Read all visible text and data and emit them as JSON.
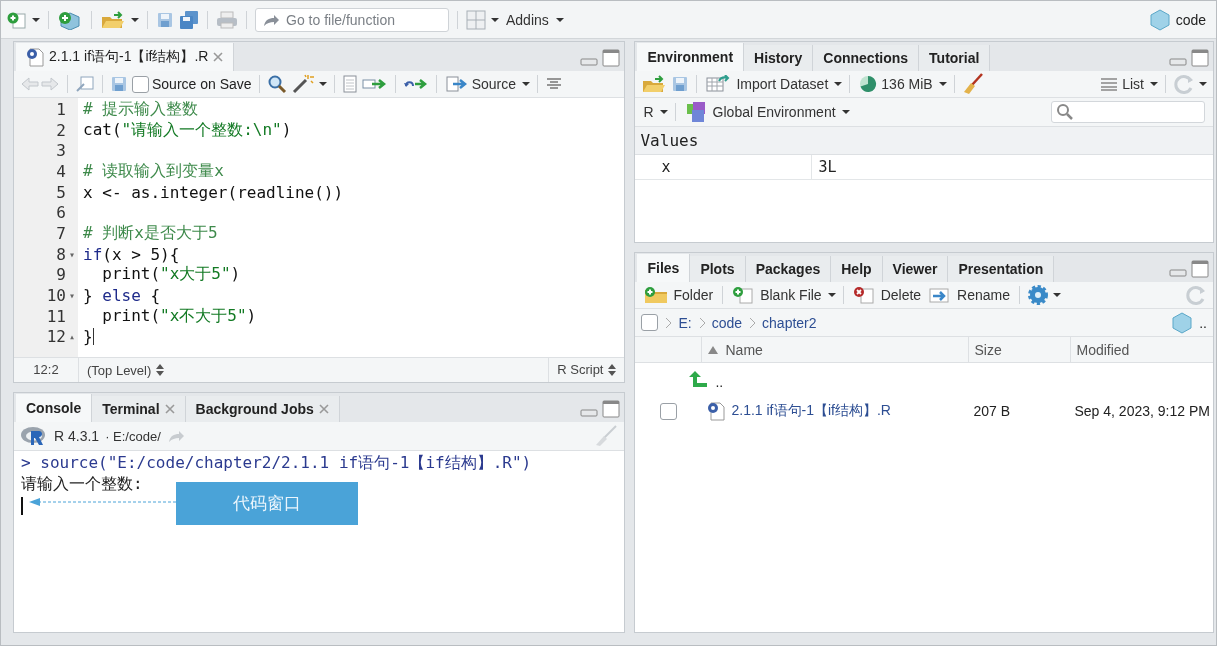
{
  "toolbar": {
    "go_to_placeholder": "Go to file/function",
    "addins": "Addins",
    "project": "code"
  },
  "editor": {
    "tabs": [
      {
        "label": "2.1.1 if语句-1【if结构】.R",
        "selected": true
      }
    ],
    "source_on_save": {
      "label": "Source on Save",
      "checked": false
    },
    "source_button": "Source",
    "lines": [
      {
        "number": "1",
        "tokens": [
          {
            "kind": "comment",
            "text": "# 提示输入整数"
          }
        ]
      },
      {
        "number": "2",
        "tokens": [
          {
            "kind": "plain",
            "text": "cat("
          },
          {
            "kind": "string",
            "text": "\"请输入一个整数:\\n\""
          },
          {
            "kind": "plain",
            "text": ")"
          }
        ]
      },
      {
        "number": "3"
      },
      {
        "number": "4",
        "tokens": [
          {
            "kind": "comment",
            "text": "# 读取输入到变量x"
          }
        ]
      },
      {
        "number": "5",
        "tokens": [
          {
            "kind": "plain",
            "text": "x <- as.integer(readline())"
          }
        ]
      },
      {
        "number": "6"
      },
      {
        "number": "7",
        "tokens": [
          {
            "kind": "comment",
            "text": "# 判断x是否大于5"
          }
        ]
      },
      {
        "number": "8",
        "fold": "▾",
        "tokens": [
          {
            "kind": "keyword",
            "text": "if"
          },
          {
            "kind": "plain",
            "text": "(x > 5){"
          }
        ]
      },
      {
        "number": "9",
        "tokens": [
          {
            "kind": "plain",
            "text": "  print("
          },
          {
            "kind": "string",
            "text": "\"x大于5\""
          },
          {
            "kind": "plain",
            "text": ")"
          }
        ]
      },
      {
        "number": "10",
        "fold": "▾",
        "tokens": [
          {
            "kind": "plain",
            "text": "} "
          },
          {
            "kind": "keyword",
            "text": "else"
          },
          {
            "kind": "plain",
            "text": " {"
          }
        ]
      },
      {
        "number": "11",
        "tokens": [
          {
            "kind": "plain",
            "text": "  print("
          },
          {
            "kind": "string",
            "text": "\"x不大于5\""
          },
          {
            "kind": "plain",
            "text": ")"
          }
        ]
      },
      {
        "number": "12",
        "fold": "▴",
        "cursor": true,
        "tokens": [
          {
            "kind": "plain",
            "text": "}"
          }
        ]
      }
    ],
    "cursor_position": "12:2",
    "scope": "(Top Level)",
    "file_type": "R Script"
  },
  "console": {
    "tabs": [
      {
        "label": "Console",
        "selected": true,
        "closable": false
      },
      {
        "label": "Terminal",
        "selected": false,
        "closable": true
      },
      {
        "label": "Background Jobs",
        "selected": false,
        "closable": true
      }
    ],
    "version": "R 4.3.1",
    "path": "· E:/code/",
    "lines": [
      {
        "kind": "input",
        "text": "> source(\"E:/code/chapter2/2.1.1 if语句-1【if结构】.R\")"
      },
      {
        "kind": "output",
        "text": "请输入一个整数:"
      }
    ],
    "callout": "代码窗口"
  },
  "environment": {
    "tabs": [
      {
        "label": "Environment",
        "selected": true
      },
      {
        "label": "History",
        "selected": false
      },
      {
        "label": "Connections",
        "selected": false
      },
      {
        "label": "Tutorial",
        "selected": false
      }
    ],
    "import_dataset": "Import Dataset",
    "memory": "136 MiB",
    "view_mode": "List",
    "language": "R",
    "scope": "Global Environment",
    "section": "Values",
    "variables": [
      {
        "name": "x",
        "value": "3L"
      }
    ]
  },
  "files": {
    "tabs": [
      {
        "label": "Files",
        "selected": true
      },
      {
        "label": "Plots",
        "selected": false
      },
      {
        "label": "Packages",
        "selected": false
      },
      {
        "label": "Help",
        "selected": false
      },
      {
        "label": "Viewer",
        "selected": false
      },
      {
        "label": "Presentation",
        "selected": false
      }
    ],
    "toolbar": [
      {
        "kind": "folder",
        "label": "Folder"
      },
      {
        "kind": "blank",
        "label": "Blank File"
      },
      {
        "kind": "delete",
        "label": "Delete"
      },
      {
        "kind": "rename",
        "label": "Rename"
      }
    ],
    "select_all": {
      "checked": false
    },
    "breadcrumb": [
      "E:",
      "code",
      "chapter2"
    ],
    "overflow": "..",
    "columns": [
      "Name",
      "Size",
      "Modified"
    ],
    "rows": [
      {
        "kind": "parent",
        "name": ".."
      },
      {
        "kind": "file",
        "name": "2.1.1 if语句-1【if结构】.R",
        "size": "207 B",
        "modified": "Sep 4, 2023, 9:12 PM",
        "checked": false
      }
    ]
  }
}
